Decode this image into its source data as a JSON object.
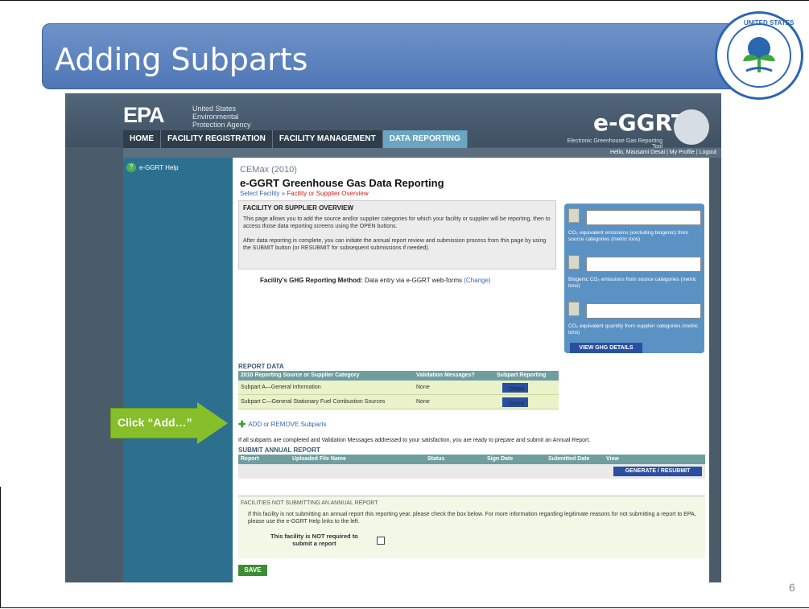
{
  "slide": {
    "title": "Adding Subparts",
    "page_number": "6",
    "seal_text_top": "UNITED STATES",
    "seal_text_right": "ENVIRONMENTAL PROTECTION AGENCY"
  },
  "app": {
    "logo": "EPA",
    "logo_sub": "United States Environmental Protection Agency",
    "brand": "e-GGRT",
    "brand_sub": "Electronic Greenhouse Gas Reporting Tool",
    "nav": [
      "HOME",
      "FACILITY REGISTRATION",
      "FACILITY MANAGEMENT",
      "DATA REPORTING"
    ],
    "user_links": "Hello, Mausami Desai | My Profile | Logout",
    "help_label": "e-GGRT Help"
  },
  "main": {
    "facility": "CEMax (2010)",
    "title": "e-GGRT Greenhouse Gas Data Reporting",
    "breadcrumb_1": "Select Facility",
    "breadcrumb_sep": "»",
    "breadcrumb_2": "Facility or Supplier Overview",
    "overview_title": "FACILITY OR SUPPLIER OVERVIEW",
    "overview_p1": "This page allows you to add the source and/or supplier categories for which your facility or supplier will be reporting, then to access those data reporting screens using the OPEN buttons.",
    "overview_p2": "After data reporting is complete, you can initiate the annual report review and submission process from this page by using the SUBMIT button (or RESUBMIT for subsequent submissions if needed).",
    "method_label": "Facility's GHG Reporting Method:",
    "method_value": "Data entry via e-GGRT web-forms",
    "method_change": "(Change)",
    "emissions": [
      {
        "label": "CO₂ equivalent emissions (excluding biogenic) from source categories (metric tons)",
        "value": ""
      },
      {
        "label": "Biogenic CO₂ emissions from source categories (metric tons)",
        "value": ""
      },
      {
        "label": "CO₂ equivalent quantity from supplier categories (metric tons)",
        "value": ""
      }
    ],
    "view_details": "VIEW GHG DETAILS",
    "report_data_label": "REPORT DATA",
    "report_columns": [
      "2010 Reporting Source or Supplier Category",
      "Validation Messages?",
      "Subpart Reporting"
    ],
    "report_rows": [
      {
        "category": "Subpart A—General Information",
        "validation": "None",
        "action": "OPEN"
      },
      {
        "category": "Subpart C—General Stationary Fuel Combustion Sources",
        "validation": "None",
        "action": "OPEN"
      }
    ],
    "add_remove": "ADD or REMOVE Subparts",
    "subparts_msg": "If all subparts are completed and Validation Messages addressed to your satisfaction, you are ready to prepare and submit an Annual Report.",
    "submit_label": "SUBMIT ANNUAL REPORT",
    "submit_columns": [
      "Report",
      "Uploaded File Name",
      "Status",
      "Sign Date",
      "Submitted Date",
      "View"
    ],
    "generate_btn": "GENERATE / RESUBMIT",
    "facilities_title": "FACILITIES NOT SUBMITTING AN ANNUAL REPORT",
    "facilities_text": "If this facility is not submitting an annual report this reporting year, please check the box below. For more information regarding legitimate reasons for not submitting a report to EPA, please use the e-GGRT Help links to the left.",
    "checkbox_label_1": "This facility is NOT required to",
    "checkbox_label_2": "submit a report",
    "save": "SAVE"
  },
  "callout": {
    "text": "Click “Add…”",
    "color": "#86bf2a"
  }
}
